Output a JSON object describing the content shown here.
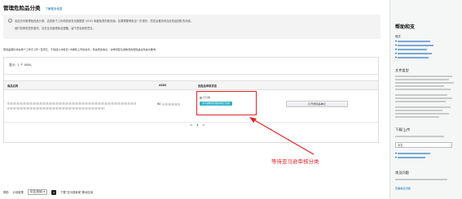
{
  "header": {
    "title": "管理危险品分类",
    "learn_more": "了解更多信息"
  },
  "notice": {
    "info_icon": "info-icon",
    "line1": "欢迎访问管理危险品分类。这是用于上传和查阅安全数据表 (SDS) 和豁免表的新页面。如果需要审批这一步操作，您还会看到来自危险品团队的消息。",
    "line2": "我们将审查您的更改，请在全页面更新此提醒，留下您全面的意见。"
  },
  "description": {
    "text": "危险品团队将在两个工作日 (周一至周五，不包括公共假日) 内审核上传的文件，有关更多信息，请参阅亚马逊物流的危险品文件提交要求。",
    "link": "亚马逊物流的危险品文件提交要求"
  },
  "table": {
    "count": "显示：1 个 ASIN。",
    "columns": [
      "商品名称",
      "ASIN",
      "危险品审核状态"
    ],
    "row": {
      "asin": "B0",
      "status": "已分类",
      "badge": "亚马逊物流危险品审核已完成",
      "action_button": "打开危险品单元"
    }
  },
  "pagination": {
    "prev": "<",
    "current": "1",
    "next": ">"
  },
  "annotation": {
    "text": "等待亚马逊审核分类",
    "color": "#e0262b"
  },
  "footer": {
    "help": "帮助",
    "policy": "计划政策",
    "language": "中文(简体)",
    "app_icon": "seller-app-icon",
    "app_text": "下载“亚马逊卖家”移动应用"
  },
  "right_panel": {
    "title": "帮助和支",
    "overview": "概述",
    "file_types": "文件类型",
    "next_steps": "下载/上传",
    "language_value": "中文",
    "faq": "常见问题",
    "bottom_link": "查看常见问题"
  }
}
